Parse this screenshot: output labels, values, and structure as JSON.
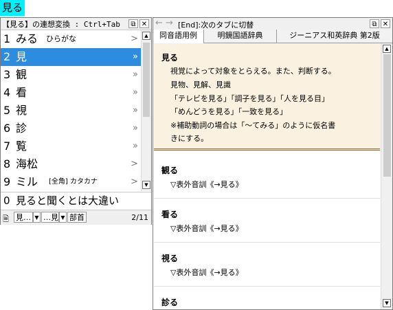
{
  "input_text": "見る",
  "candidate_window": {
    "title": "【見る】の連想変換 : Ctrl+Tab",
    "candidates": [
      {
        "num": "1",
        "word": "みる",
        "sub": "ひらがな",
        "arrow": ">"
      },
      {
        "num": "2",
        "word": "見",
        "sub": "",
        "arrow": "»"
      },
      {
        "num": "3",
        "word": "観",
        "sub": "",
        "arrow": "»"
      },
      {
        "num": "4",
        "word": "看",
        "sub": "",
        "arrow": "»"
      },
      {
        "num": "5",
        "word": "視",
        "sub": "",
        "arrow": "»"
      },
      {
        "num": "6",
        "word": "診",
        "sub": "",
        "arrow": "»"
      },
      {
        "num": "7",
        "word": "覧",
        "sub": "",
        "arrow": "»"
      },
      {
        "num": "8",
        "word": "海松",
        "sub": "",
        "arrow": ">"
      },
      {
        "num": "9",
        "word": "ミル",
        "sub": "[全角] カタカナ",
        "arrow": ">"
      }
    ],
    "selected_index": 1,
    "extra": {
      "num": "0",
      "word": "見ると聞くとは大違い"
    },
    "footer": {
      "box1": "見…",
      "box2": "…見",
      "box3": "部首",
      "page": "2/11"
    }
  },
  "dict_window": {
    "title": "[End]:次のタブに切替",
    "tabs": [
      "同音語用例",
      "明鏡国語辞典",
      "ジーニアス和英辞典 第2版"
    ],
    "active_tab": 0,
    "main_entry": {
      "headword": "見る",
      "lines": [
        "視覚によって対象をとらえる。また、判断する。",
        "見物、見解、見識",
        "「テレビを見る」「調子を見る」「人を見る目」",
        "「めんどうを見る」「一致を見る」",
        "※補助動詞の場合は「～てみる」のように仮名書",
        "きにする。"
      ]
    },
    "entries": [
      {
        "headword": "観る",
        "detail": "▽表外音訓《→見る》"
      },
      {
        "headword": "看る",
        "detail": "▽表外音訓《→見る》"
      },
      {
        "headword": "視る",
        "detail": "▽表外音訓《→見る》"
      },
      {
        "headword": "診る",
        "detail": ""
      }
    ]
  }
}
